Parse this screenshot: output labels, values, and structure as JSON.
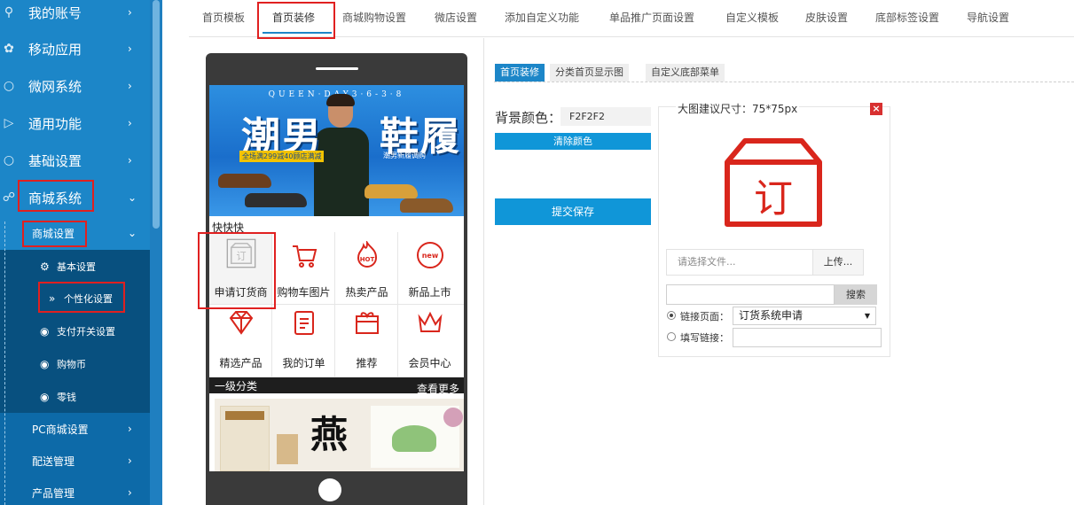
{
  "sidebar": {
    "items": [
      {
        "label": "我的账号",
        "icon": "user-icon"
      },
      {
        "label": "移动应用",
        "icon": "apps-icon"
      },
      {
        "label": "微网系统",
        "icon": "globe-icon"
      },
      {
        "label": "通用功能",
        "icon": "share-icon"
      },
      {
        "label": "基础设置",
        "icon": "globe-icon"
      },
      {
        "label": "商城系统",
        "icon": "cart-icon"
      }
    ],
    "mall_settings": "商城设置",
    "leaf_items": [
      "基本设置",
      "个性化设置",
      "支付开关设置",
      "购物币",
      "零钱"
    ],
    "more_items": [
      "PC商城设置",
      "配送管理",
      "产品管理"
    ]
  },
  "tabs": [
    "首页模板",
    "首页装修",
    "商城购物设置",
    "微店设置",
    "添加自定义功能",
    "单品推广页面设置",
    "自定义模板",
    "皮肤设置",
    "底部标签设置",
    "导航设置"
  ],
  "phone": {
    "banner": {
      "top_text": "QUEEN·DAY3·6-3·8",
      "left_title": "潮男",
      "right_title": "鞋履",
      "promo": "全场满299减40顾店满减",
      "promo2": "潮男新履调购"
    },
    "group_title": "快快快",
    "grid": [
      {
        "label": "申请订货商",
        "icon": "order-box-icon"
      },
      {
        "label": "购物车图片",
        "icon": "shopping-cart-icon"
      },
      {
        "label": "热卖产品",
        "icon": "hot-icon"
      },
      {
        "label": "新品上市",
        "icon": "new-icon"
      },
      {
        "label": "精选产品",
        "icon": "diamond-icon"
      },
      {
        "label": "我的订单",
        "icon": "clipboard-icon"
      },
      {
        "label": "推荐",
        "icon": "gift-icon"
      },
      {
        "label": "会员中心",
        "icon": "crown-icon"
      }
    ],
    "category_title": "一级分类",
    "category_more": "查看更多"
  },
  "panel": {
    "tabs": [
      "首页装修",
      "分类首页显示图",
      "自定义底部菜单"
    ],
    "bg_label": "背景颜色：",
    "bg_value": "F2F2F2",
    "clear_color": "清除颜色",
    "submit": "提交保存",
    "size_hint": "大图建议尺寸：75*75px",
    "close": "×",
    "file_placeholder": "请选择文件...",
    "upload": "上传...",
    "search": "搜索",
    "link_page_label": "链接页面：",
    "link_page_value": "订货系统申请",
    "custom_link_label": "填写链接："
  },
  "colors": {
    "accent": "#1c86c8",
    "highlight": "#e02020",
    "icon_red": "#d9261c"
  }
}
